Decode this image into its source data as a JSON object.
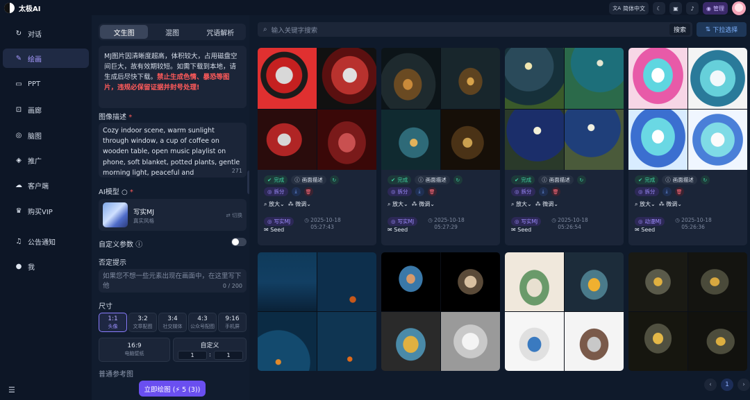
{
  "app": {
    "name": "太极AI"
  },
  "topbar": {
    "lang": "简体中文",
    "admin": "管理"
  },
  "sidebar": {
    "items": [
      {
        "icon": "chat-icon",
        "glyph": "↻",
        "label": "对话"
      },
      {
        "icon": "paint-icon",
        "glyph": "✎",
        "label": "绘画"
      },
      {
        "icon": "ppt-icon",
        "glyph": "▭",
        "label": "PPT"
      },
      {
        "icon": "gallery-icon",
        "glyph": "⊡",
        "label": "画廊"
      },
      {
        "icon": "mindmap-icon",
        "glyph": "◎",
        "label": "脑图"
      },
      {
        "icon": "promote-icon",
        "glyph": "◈",
        "label": "推广"
      },
      {
        "icon": "client-icon",
        "glyph": "☁",
        "label": "客户端"
      },
      {
        "icon": "vip-icon",
        "glyph": "♛",
        "label": "购买VIP"
      },
      {
        "icon": "bell-icon",
        "glyph": "♫",
        "label": "公告通知"
      },
      {
        "icon": "user-icon",
        "glyph": "●",
        "label": "我"
      }
    ]
  },
  "panel": {
    "tabs": [
      "文生图",
      "混图",
      "咒语解析"
    ],
    "notice": "MJ图片因清晰度超高，体积较大，占用磁盘空间巨大，故有效期较短。如需下载到本地，请生成后尽快下载。",
    "notice_warn": "禁止生成色情、暴恐等图片，违规必保留证据并封号处理!",
    "desc_label": "图像描述",
    "desc_text": "Cozy indoor scene, warm sunlight through window, a cup of coffee on wooden table, open music playlist on phone, soft blanket, potted plants, gentle morning light, peaceful and",
    "desc_count": "271",
    "model_label": "AI模型",
    "model_name": "写实MJ",
    "model_sub": "真实风格",
    "model_switch": "切换",
    "custom_label": "自定义参数",
    "neg_label": "否定提示",
    "neg_placeholder": "如果您不想一些元素出现在画面中，在这里写下他",
    "neg_count": "0 / 200",
    "size_label": "尺寸",
    "ratios": [
      {
        "r": "1:1",
        "s": "头像"
      },
      {
        "r": "3:2",
        "s": "文章配图"
      },
      {
        "r": "3:4",
        "s": "社交媒体"
      },
      {
        "r": "4:3",
        "s": "公众号配图"
      },
      {
        "r": "9:16",
        "s": "手机屏"
      }
    ],
    "ratio2": {
      "r": "16:9",
      "s": "电脑壁纸"
    },
    "custom": {
      "title": "自定义",
      "w": "1",
      "h": "1"
    },
    "extra_label": "普通参考图",
    "generate": "立即绘图 (⚡ 5 (3))"
  },
  "main": {
    "search_placeholder": "输入关键字搜索",
    "search_btn": "搜索",
    "filter_btn": "下拉选择",
    "cards": [
      {
        "status": "完成",
        "desc": "画面描述",
        "model": "写实MJ",
        "date": "2025-10-18",
        "time": "05:27:43",
        "seed": "Seed"
      },
      {
        "status": "完成",
        "desc": "画面描述",
        "model": "写实MJ",
        "date": "2025-10-18",
        "time": "05:27:29",
        "seed": "Seed"
      },
      {
        "status": "完成",
        "desc": "画面描述",
        "model": "写实MJ",
        "date": "2025-10-18",
        "time": "05:26:54",
        "seed": "Seed"
      },
      {
        "status": "完成",
        "desc": "画面描述",
        "model": "动漫MJ",
        "date": "2025-10-18",
        "time": "05:26:36",
        "seed": "Seed"
      }
    ],
    "action_label": "拆分",
    "zoom": "放大",
    "vary": "微调",
    "page": "1"
  },
  "colors": {
    "accent": "#6a4ff0",
    "status_green": "#3fd0a0",
    "danger": "#ff5a5a"
  }
}
